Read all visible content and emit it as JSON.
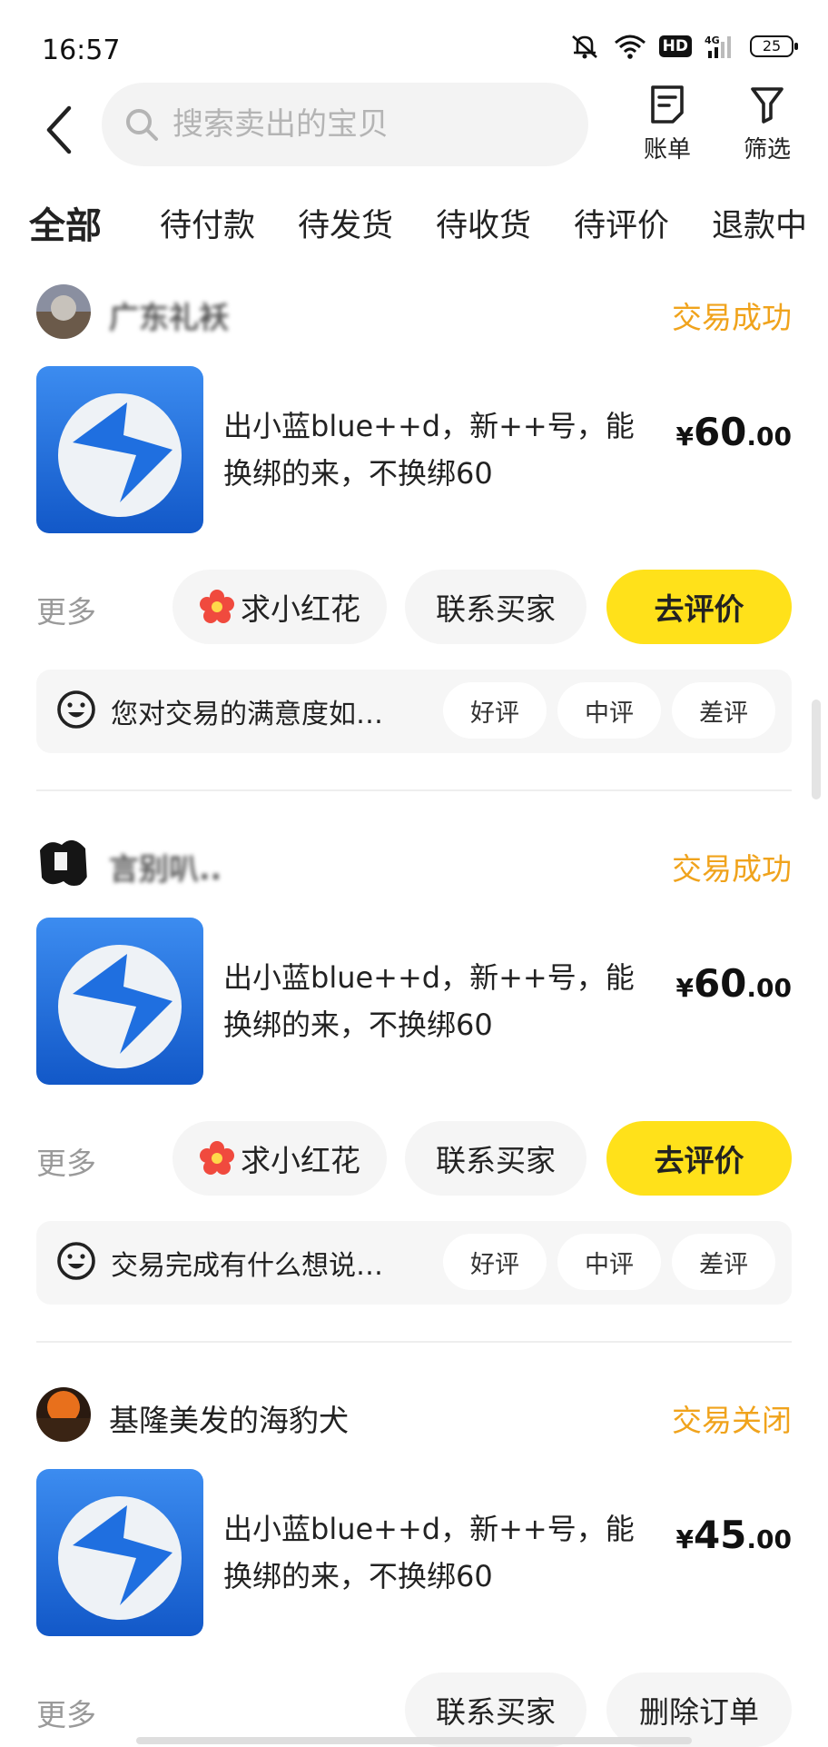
{
  "status_bar": {
    "time": "16:57",
    "network": "4G",
    "hd": "HD",
    "battery": "25"
  },
  "header": {
    "search_placeholder": "搜索卖出的宝贝",
    "bill_label": "账单",
    "filter_label": "筛选"
  },
  "tabs": [
    {
      "label": "全部",
      "active": true
    },
    {
      "label": "待付款"
    },
    {
      "label": "待发货"
    },
    {
      "label": "待收货"
    },
    {
      "label": "待评价"
    },
    {
      "label": "退款中"
    }
  ],
  "orders": [
    {
      "buyer": "广东礼袄",
      "status": "交易成功",
      "title": "出小蓝blue++d，新++号，能换绑的来，不换绑60",
      "price_currency": "¥",
      "price_int": "60",
      "price_dec": ".00",
      "more": "更多",
      "flower_btn": "求小红花",
      "contact_btn": "联系买家",
      "primary_btn": "去评价",
      "review_question": "您对交易的满意度如…",
      "review_options": [
        "好评",
        "中评",
        "差评"
      ]
    },
    {
      "buyer": "言别叭..",
      "status": "交易成功",
      "title": "出小蓝blue++d，新++号，能换绑的来，不换绑60",
      "price_currency": "¥",
      "price_int": "60",
      "price_dec": ".00",
      "more": "更多",
      "flower_btn": "求小红花",
      "contact_btn": "联系买家",
      "primary_btn": "去评价",
      "review_question": "交易完成有什么想说…",
      "review_options": [
        "好评",
        "中评",
        "差评"
      ]
    },
    {
      "buyer": "基隆美发的海豹犬",
      "status": "交易关闭",
      "title": "出小蓝blue++d，新++号，能换绑的来，不换绑60",
      "price_currency": "¥",
      "price_int": "45",
      "price_dec": ".00",
      "more": "更多",
      "contact_btn": "联系买家",
      "delete_btn": "删除订单"
    }
  ],
  "colors": {
    "accent_yellow": "#ffe11a",
    "status_orange": "#f0a31c",
    "flower_red": "#f04a3e",
    "app_icon_blue": "#1f6fe0"
  },
  "icons": [
    "back-icon",
    "search-icon",
    "bill-icon",
    "filter-icon",
    "flower-icon",
    "smile-face-icon",
    "blue-app-icon"
  ]
}
